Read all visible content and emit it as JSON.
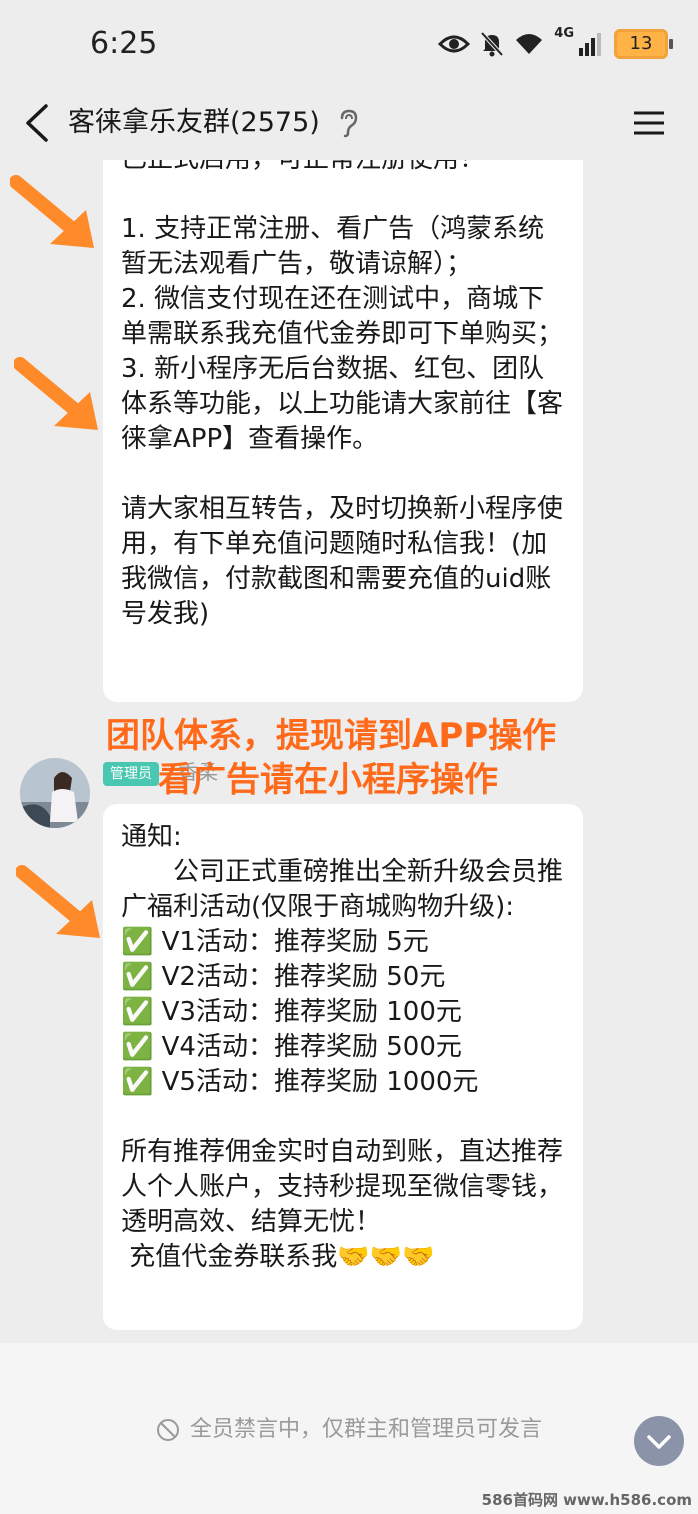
{
  "status_bar": {
    "time": "6:25",
    "battery": "13",
    "network": "4G",
    "icons": [
      "eye-comfort-icon",
      "mute-bell-icon",
      "wifi-icon",
      "signal-icon",
      "battery-icon"
    ]
  },
  "nav": {
    "title": "客徕拿乐友群(2575)",
    "icons": [
      "back-icon",
      "ear-icon",
      "menu-icon"
    ]
  },
  "messages": [
    {
      "text": "已正式启用，可正常注册使用！\n\n1. 支持正常注册、看广告（鸿蒙系统暂无法观看广告，敬请谅解）；\n2. 微信支付现在还在测试中，商城下单需联系我充值代金券即可下单购买；\n3. 新小程序无后台数据、红包、团队体系等功能，以上功能请大家前往【客徕拿APP】查看操作。\n\n请大家相互转告，及时切换新小程序使用，有下单充值问题随时私信我！(加我微信，付款截图和需要充值的uid账号发我)"
    },
    {
      "sender_badge": "管理员",
      "sender_name": "香柔",
      "text": "通知:\n　　公司正式重磅推出全新升级会员推广福利活动(仅限于商城购物升级):\n✅ V1活动：推荐奖励 5元\n✅ V2活动：推荐奖励 50元\n✅ V3活动：推荐奖励 100元\n✅ V4活动：推荐奖励 500元\n✅ V5活动：推荐奖励 1000元\n\n所有推荐佣金实时自动到账，直达推荐人个人账户，支持秒提现至微信零钱，透明高效、结算无忧！\n 充值代金券联系我🤝🤝🤝"
    }
  ],
  "overlay": {
    "line1": "团队体系，提现请到APP操作",
    "line2": "看广告请在小程序操作",
    "color": "#ff6a1a"
  },
  "bottom": {
    "muted_notice": "全员禁言中，仅群主和管理员可发言"
  },
  "watermark": "586首码网 www.h586.com",
  "colors": {
    "background": "#ededed",
    "bubble": "#ffffff",
    "admin_badge": "#4ac7b0",
    "arrow": "#ff8a2a"
  }
}
